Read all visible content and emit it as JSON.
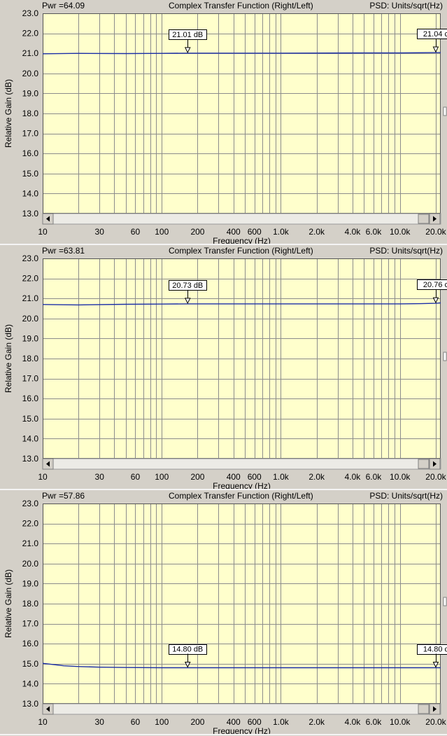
{
  "panels": [
    {
      "pwr_label": "Pwr =64.09",
      "title": "Complex Transfer Function (Right/Left)",
      "units": "PSD: Units/sqrt(Hz)",
      "markers": [
        {
          "x": 165,
          "text": "21.01 dB"
        },
        {
          "x": 20000,
          "text": "21.04 c"
        }
      ]
    },
    {
      "pwr_label": "Pwr =63.81",
      "title": "Complex Transfer Function (Right/Left)",
      "units": "PSD: Units/sqrt(Hz)",
      "markers": [
        {
          "x": 165,
          "text": "20.73 dB"
        },
        {
          "x": 20000,
          "text": "20.76 c"
        }
      ]
    },
    {
      "pwr_label": "Pwr =57.86",
      "title": "Complex Transfer Function (Right/Left)",
      "units": "PSD: Units/sqrt(Hz)",
      "markers": [
        {
          "x": 165,
          "text": "14.80 dB"
        },
        {
          "x": 20000,
          "text": "14.80 c"
        }
      ]
    }
  ],
  "chart_data": [
    {
      "type": "line",
      "title": "Complex Transfer Function (Right/Left)",
      "xlabel": "Frequency (Hz)",
      "ylabel": "Relative Gain (dB)",
      "xscale": "log",
      "xlim": [
        10,
        22000
      ],
      "ylim": [
        13.0,
        23.0
      ],
      "xticks": [
        10,
        30,
        60,
        100,
        200,
        400,
        600,
        1000,
        2000,
        4000,
        6000,
        10000,
        20000
      ],
      "xtick_labels": [
        "10",
        "30",
        "60",
        "100",
        "200",
        "400",
        "600",
        "1.0k",
        "2.0k",
        "4.0k",
        "6.0k",
        "10.0k",
        "20.0k"
      ],
      "yticks": [
        13.0,
        14.0,
        15.0,
        16.0,
        17.0,
        18.0,
        19.0,
        20.0,
        21.0,
        22.0,
        23.0
      ],
      "ytick_labels": [
        "13.0",
        "14.0",
        "15.0",
        "16.0",
        "17.0",
        "18.0",
        "19.0",
        "20.0",
        "21.0",
        "22.0",
        "23.0"
      ],
      "grid": true,
      "series": [
        {
          "x": [
            10,
            20,
            50,
            100,
            165,
            500,
            1000,
            5000,
            10000,
            20000,
            22000
          ],
          "y": [
            20.98,
            21.0,
            20.99,
            21.0,
            21.01,
            21.01,
            21.01,
            21.02,
            21.02,
            21.04,
            21.04
          ]
        }
      ]
    },
    {
      "type": "line",
      "title": "Complex Transfer Function (Right/Left)",
      "xlabel": "Frequency (Hz)",
      "ylabel": "Relative Gain (dB)",
      "xscale": "log",
      "xlim": [
        10,
        22000
      ],
      "ylim": [
        13.0,
        23.0
      ],
      "xticks": [
        10,
        30,
        60,
        100,
        200,
        400,
        600,
        1000,
        2000,
        4000,
        6000,
        10000,
        20000
      ],
      "xtick_labels": [
        "10",
        "30",
        "60",
        "100",
        "200",
        "400",
        "600",
        "1.0k",
        "2.0k",
        "4.0k",
        "6.0k",
        "10.0k",
        "20.0k"
      ],
      "yticks": [
        13.0,
        14.0,
        15.0,
        16.0,
        17.0,
        18.0,
        19.0,
        20.0,
        21.0,
        22.0,
        23.0
      ],
      "ytick_labels": [
        "13.0",
        "14.0",
        "15.0",
        "16.0",
        "17.0",
        "18.0",
        "19.0",
        "20.0",
        "21.0",
        "22.0",
        "23.0"
      ],
      "grid": true,
      "series": [
        {
          "x": [
            10,
            20,
            50,
            100,
            165,
            500,
            1000,
            5000,
            10000,
            15000,
            20000,
            22000
          ],
          "y": [
            20.7,
            20.68,
            20.71,
            20.72,
            20.73,
            20.73,
            20.73,
            20.73,
            20.73,
            20.74,
            20.76,
            20.78
          ]
        }
      ]
    },
    {
      "type": "line",
      "title": "Complex Transfer Function (Right/Left)",
      "xlabel": "Frequency (Hz)",
      "ylabel": "Relative Gain (dB)",
      "xscale": "log",
      "xlim": [
        10,
        22000
      ],
      "ylim": [
        13.0,
        23.0
      ],
      "xticks": [
        10,
        30,
        60,
        100,
        200,
        400,
        600,
        1000,
        2000,
        4000,
        6000,
        10000,
        20000
      ],
      "xtick_labels": [
        "10",
        "30",
        "60",
        "100",
        "200",
        "400",
        "600",
        "1.0k",
        "2.0k",
        "4.0k",
        "6.0k",
        "10.0k",
        "20.0k"
      ],
      "yticks": [
        13.0,
        14.0,
        15.0,
        16.0,
        17.0,
        18.0,
        19.0,
        20.0,
        21.0,
        22.0,
        23.0
      ],
      "ytick_labels": [
        "13.0",
        "14.0",
        "15.0",
        "16.0",
        "17.0",
        "18.0",
        "19.0",
        "20.0",
        "21.0",
        "22.0",
        "23.0"
      ],
      "grid": true,
      "series": [
        {
          "x": [
            10,
            15,
            20,
            30,
            50,
            100,
            165,
            500,
            1000,
            5000,
            10000,
            20000,
            22000
          ],
          "y": [
            15.02,
            14.9,
            14.86,
            14.83,
            14.81,
            14.8,
            14.8,
            14.8,
            14.8,
            14.8,
            14.8,
            14.8,
            14.8
          ]
        }
      ]
    }
  ],
  "colors": {
    "plot_bg": "#ffffcc",
    "trace": "#1c2fa8",
    "grid": "#8c8c8c",
    "window_bg": "#d4d0c8"
  },
  "icons": [
    "arrow-left-icon",
    "arrow-right-icon",
    "marker-triangle-icon"
  ]
}
